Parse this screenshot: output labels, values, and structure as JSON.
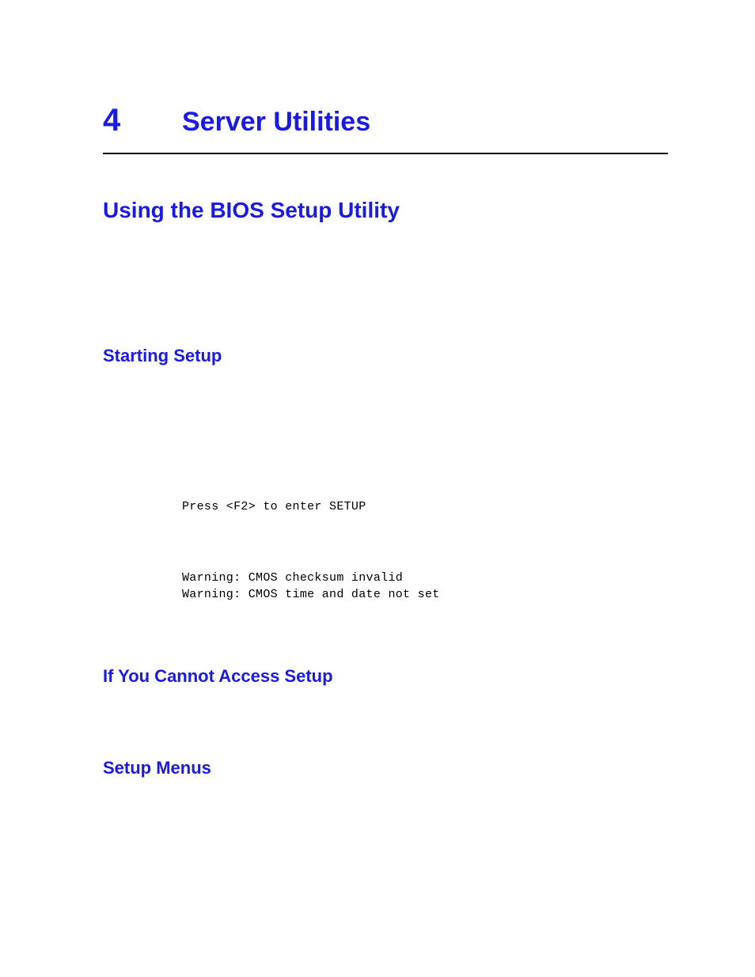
{
  "chapter": {
    "number": "4",
    "title": "Server Utilities"
  },
  "section": {
    "heading": "Using the BIOS Setup Utility"
  },
  "subsections": {
    "starting": {
      "heading": "Starting Setup",
      "code_line_1": "Press <F2> to enter SETUP",
      "code_line_2": "Warning: CMOS checksum invalid",
      "code_line_3": "Warning: CMOS time and date not set"
    },
    "cannot_access": {
      "heading": "If You Cannot Access Setup"
    },
    "setup_menus": {
      "heading": "Setup Menus"
    }
  }
}
